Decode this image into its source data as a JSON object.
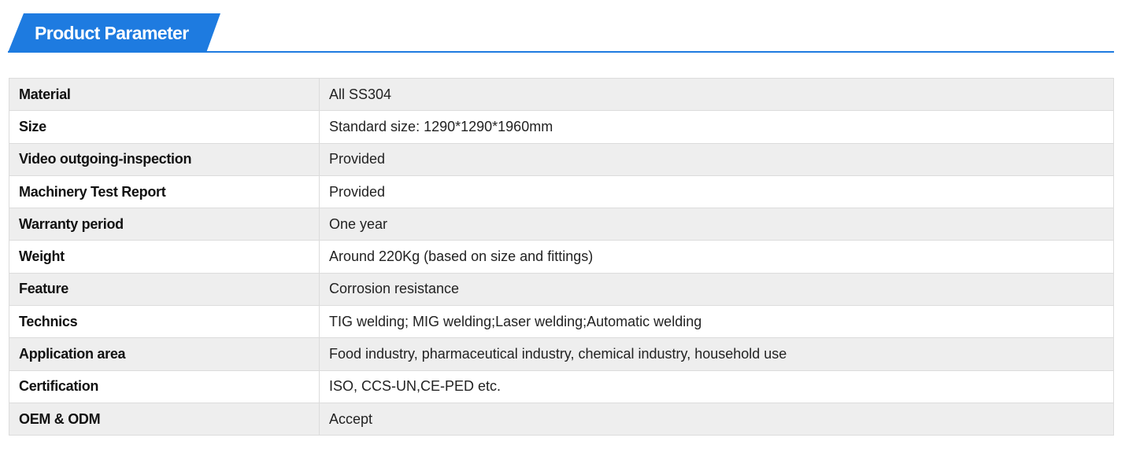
{
  "header": {
    "title": "Product Parameter"
  },
  "colors": {
    "accent": "#1e7be0",
    "row_alt": "#eeeeee",
    "border": "#dcdcdc"
  },
  "parameters": [
    {
      "label": "Material",
      "value": "All SS304"
    },
    {
      "label": "Size",
      "value": "Standard size: 1290*1290*1960mm"
    },
    {
      "label": "Video outgoing-inspection",
      "value": "Provided"
    },
    {
      "label": "Machinery Test Report",
      "value": "Provided"
    },
    {
      "label": "Warranty period",
      "value": "One year"
    },
    {
      "label": "Weight",
      "value": "Around 220Kg (based on size and fittings)"
    },
    {
      "label": "Feature",
      "value": "Corrosion resistance"
    },
    {
      "label": "Technics",
      "value": "TIG welding; MIG welding;Laser welding;Automatic welding"
    },
    {
      "label": "Application area",
      "value": "Food industry, pharmaceutical industry, chemical industry, household use"
    },
    {
      "label": "Certification",
      "value": "ISO, CCS-UN,CE-PED etc."
    },
    {
      "label": "OEM & ODM",
      "value": "Accept"
    }
  ]
}
